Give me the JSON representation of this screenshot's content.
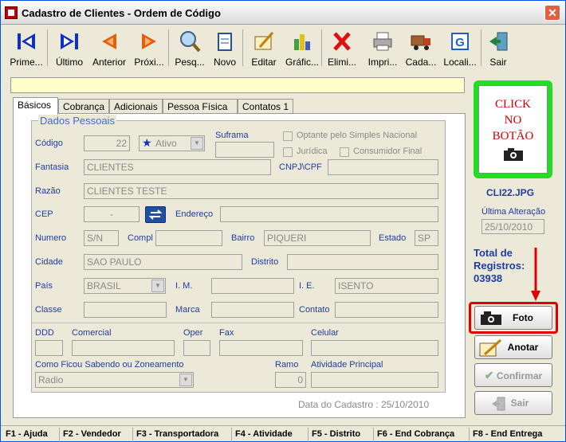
{
  "window": {
    "title": "Cadastro de Clientes - Ordem de Código",
    "close": "✕"
  },
  "toolbar": [
    {
      "label": "Prime...",
      "icon": "first-record-icon"
    },
    {
      "label": "Último",
      "icon": "last-record-icon"
    },
    {
      "label": "Anterior",
      "icon": "previous-record-icon"
    },
    {
      "label": "Próxi...",
      "icon": "next-record-icon"
    },
    {
      "label": "Pesq...",
      "icon": "search-icon"
    },
    {
      "label": "Novo",
      "icon": "new-document-icon"
    },
    {
      "label": "Editar",
      "icon": "edit-icon"
    },
    {
      "label": "Gráfic...",
      "icon": "chart-icon"
    },
    {
      "label": "Elimi...",
      "icon": "delete-icon"
    },
    {
      "label": "Impri...",
      "icon": "printer-icon"
    },
    {
      "label": "Cada...",
      "icon": "truck-icon"
    },
    {
      "label": "Locali...",
      "icon": "locate-icon"
    },
    {
      "label": "Sair",
      "icon": "exit-icon"
    }
  ],
  "tabs": [
    "Básicos",
    "Cobrança",
    "Adicionais",
    "Pessoa Física",
    "Contatos 1"
  ],
  "group_title": "Dados Pessoais",
  "labels": {
    "codigo": "Código",
    "suframa": "Suframa",
    "optante": "Optante pelo Simples Nacional",
    "juridica": "Jurídica",
    "consumidor": "Consumidor Final",
    "fantasia": "Fantasia",
    "cnpj": "CNPJ\\CPF",
    "razao": "Razão",
    "cep": "CEP",
    "endereco": "Endereço",
    "numero": "Numero",
    "compl": "Compl",
    "bairro": "Bairro",
    "estado": "Estado",
    "cidade": "Cidade",
    "distrito": "Distrito",
    "pais": "País",
    "im": "I. M.",
    "ie": "I. E.",
    "classe": "Classe",
    "marca": "Marca",
    "contato": "Contato",
    "ddd": "DDD",
    "comercial": "Comercial",
    "oper": "Oper",
    "fax": "Fax",
    "celular": "Celular",
    "como_ficou": "Como Ficou Sabendo ou Zoneamento",
    "ramo": "Ramo",
    "atividade": "Atividade Principal",
    "data_cadastro": "Data do Cadastro : 25/10/2010"
  },
  "values": {
    "codigo": "22",
    "status": "Ativo",
    "fantasia": "CLIENTES",
    "razao": "CLIENTES TESTE",
    "cep": "-",
    "numero": "S/N",
    "bairro": "PIQUERI",
    "estado": "SP",
    "cidade": "SAO PAULO",
    "pais": "BRASIL",
    "ie": "ISENTO",
    "como_ficou": "Radio",
    "ramo": "0"
  },
  "photo": {
    "text_lines": [
      "CLICK",
      "NO",
      "BOTÃO"
    ],
    "filename": "CLI22.JPG",
    "ultima_alteracao_label": "Última Alteração",
    "ultima_alteracao": "25/10/2010",
    "total_label_1": "Total de",
    "total_label_2": "Registros:",
    "total_value": "03938"
  },
  "buttons": {
    "foto": "Foto",
    "anotar": "Anotar",
    "confirmar": "Confirmar",
    "sair": "Sair"
  },
  "status_bar": [
    "F1 - Ajuda",
    "F2 - Vendedor",
    "F3 - Transportadora",
    "F4 - Atividade",
    "F5 - Distrito",
    "F6 - End Cobrança",
    "F8 - End Entrega"
  ],
  "colors": {
    "accent_green": "#22dd22",
    "photo_text": "#cc0000",
    "label_blue": "#1f3da0",
    "arrow_red": "#e00000"
  }
}
